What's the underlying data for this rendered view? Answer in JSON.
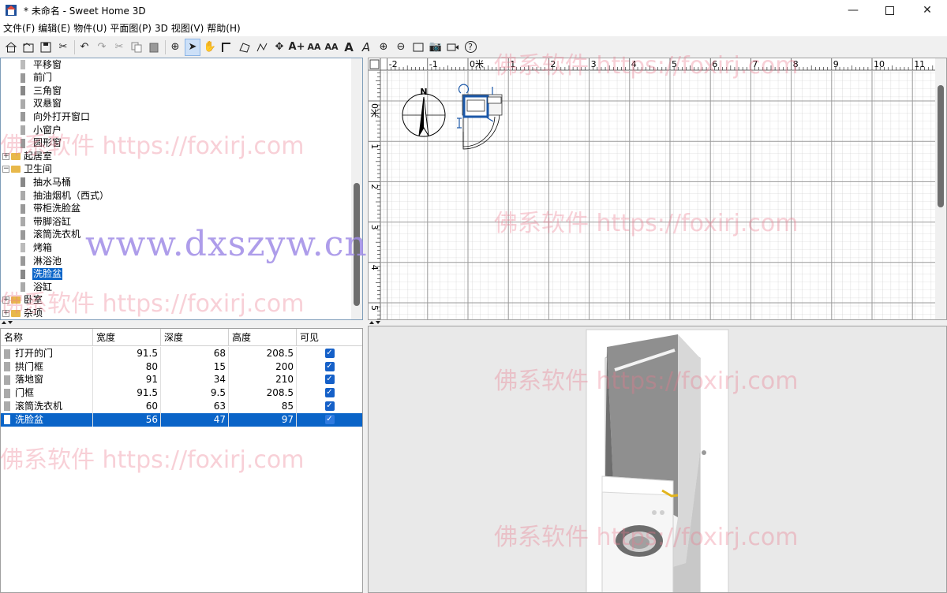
{
  "window": {
    "title": "* 未命名 - Sweet Home 3D"
  },
  "menu": [
    "文件(F)",
    "编辑(E)",
    "物件(U)",
    "平面图(P)",
    "3D 视图(V)",
    "帮助(H)"
  ],
  "toolbar": {
    "text_buttons": [
      "A",
      "A"
    ]
  },
  "catalog": {
    "items": [
      {
        "label": "平移窗",
        "level": 2
      },
      {
        "label": "前门",
        "level": 2
      },
      {
        "label": "三角窗",
        "level": 2
      },
      {
        "label": "双悬窗",
        "level": 2
      },
      {
        "label": "向外打开窗口",
        "level": 2
      },
      {
        "label": "小窗户",
        "level": 2
      },
      {
        "label": "圆形窗",
        "level": 2
      },
      {
        "label": "起居室",
        "level": 1,
        "expander": "+"
      },
      {
        "label": "卫生间",
        "level": 1,
        "expander": "−"
      },
      {
        "label": "抽水马桶",
        "level": 2
      },
      {
        "label": "抽油烟机（西式）",
        "level": 2
      },
      {
        "label": "带柜洗脸盆",
        "level": 2
      },
      {
        "label": "带脚浴缸",
        "level": 2
      },
      {
        "label": "滚筒洗衣机",
        "level": 2
      },
      {
        "label": "烤箱",
        "level": 2
      },
      {
        "label": "淋浴池",
        "level": 2
      },
      {
        "label": "洗脸盆",
        "level": 2,
        "selected": true
      },
      {
        "label": "浴缸",
        "level": 2
      },
      {
        "label": "卧室",
        "level": 1,
        "expander": "+"
      },
      {
        "label": "杂项",
        "level": 1,
        "expander": "+"
      }
    ]
  },
  "furniture_table": {
    "columns": [
      "名称",
      "宽度",
      "深度",
      "高度",
      "可见"
    ],
    "rows": [
      {
        "name": "打开的门",
        "width": "91.5",
        "depth": "68",
        "height": "208.5",
        "visible": true
      },
      {
        "name": "拱门框",
        "width": "80",
        "depth": "15",
        "height": "200",
        "visible": true
      },
      {
        "name": "落地窗",
        "width": "91",
        "depth": "34",
        "height": "210",
        "visible": true
      },
      {
        "name": "门框",
        "width": "91.5",
        "depth": "9.5",
        "height": "208.5",
        "visible": true
      },
      {
        "name": "滚筒洗衣机",
        "width": "60",
        "depth": "63",
        "height": "85",
        "visible": true
      },
      {
        "name": "洗脸盆",
        "width": "56",
        "depth": "47",
        "height": "97",
        "visible": true,
        "selected": true
      }
    ]
  },
  "plan": {
    "ruler_x": [
      "-2",
      "-1",
      "0米",
      "1",
      "2",
      "3",
      "4",
      "5",
      "6",
      "7",
      "8",
      "9",
      "10",
      "11"
    ],
    "ruler_y": [
      "0米",
      "1",
      "2",
      "3",
      "4",
      "5"
    ],
    "compass_label": "N"
  },
  "watermarks": {
    "site_a": "佛系软件 https://foxirj.com",
    "site_b": "www.dxszyw.cn"
  },
  "colors": {
    "selection": "#0a64c8",
    "checkbox": "#1560c8"
  }
}
